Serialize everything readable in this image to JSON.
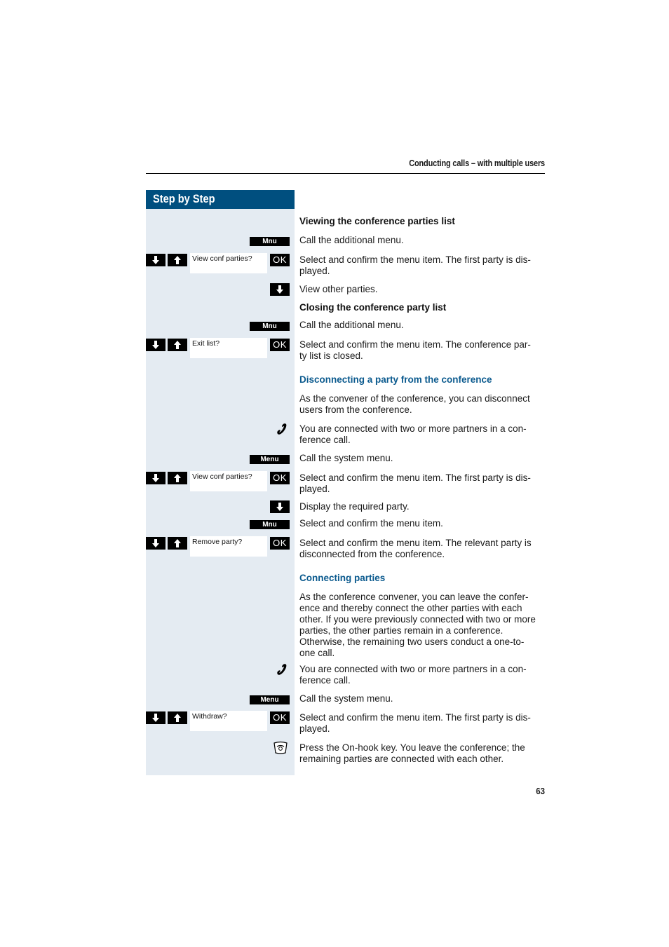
{
  "running_head": "Conducting calls – with multiple users",
  "sidebar_title": "Step by Step",
  "page_number": "63",
  "softkeys": {
    "mnu": "Mnu",
    "menu": "Menu",
    "ok": "OK"
  },
  "displays": {
    "view_conf_1": "View conf parties?",
    "exit_list": "Exit list?",
    "view_conf_2": "View conf parties?",
    "remove_party": "Remove party?",
    "withdraw": "Withdraw?"
  },
  "sections": {
    "viewing": {
      "title": "Viewing the conference parties list",
      "steps": [
        "Call the additional menu.",
        "Select and confirm the menu item. The first party is dis-\nplayed.",
        "View other parties."
      ]
    },
    "closing": {
      "title": "Closing the conference party list",
      "steps": [
        "Call the additional menu.",
        "Select and confirm the menu item. The conference par-\nty list is closed."
      ]
    },
    "disconnecting": {
      "title": "Disconnecting a party from the conference",
      "intro": "As the convener of the conference, you can disconnect users from the conference.",
      "steps": [
        "You are connected with two or more partners in a con-\nference call.",
        "Call the system menu.",
        "Select and confirm the menu item. The first party is dis-\nplayed.",
        "Display the required party.",
        "Select and confirm the menu item.",
        "Select and confirm the menu item. The relevant party is disconnected from the conference."
      ]
    },
    "connecting": {
      "title": "Connecting parties",
      "intro": "As the conference convener, you can leave the confer-\nence and thereby connect the other parties with each other. If you were previously connected with two or more parties, the other parties remain in a conference. Otherwise, the remaining two users conduct a one-to-\none call.",
      "steps": [
        "You are connected with two or more partners in a con-\nference call.",
        "Call the system menu.",
        "Select and confirm the menu item. The first party is dis-\nplayed.",
        "Press the On-hook key. You leave the conference; the remaining parties are connected with each other."
      ]
    }
  },
  "colors": {
    "brand_blue": "#004f7f",
    "heading_blue": "#0b5a8e",
    "sidebar_bg": "#e4ebf2"
  }
}
